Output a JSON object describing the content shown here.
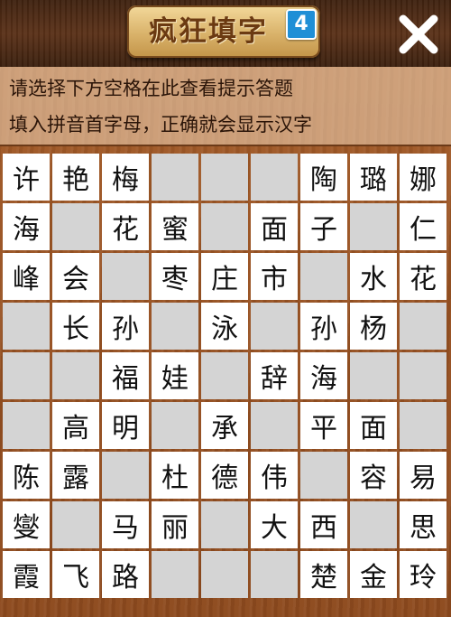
{
  "header": {
    "title": "疯狂填字",
    "badge": "4",
    "close_icon": "close-x-icon"
  },
  "hint": {
    "line1": "请选择下方空格在此查看提示答题",
    "line2": "填入拼音首字母，正确就会显示汉字"
  },
  "colors": {
    "wood": "#9a5424",
    "topbar": "#4a2814",
    "badge": "#1f8fd6",
    "cell_open": "#ffffff",
    "cell_block": "#d4d4d4"
  },
  "grid": {
    "rows": [
      [
        "许",
        "艳",
        "梅",
        null,
        null,
        null,
        "陶",
        "璐",
        "娜"
      ],
      [
        "海",
        null,
        "花",
        "蜜",
        null,
        "面",
        "子",
        null,
        "仁"
      ],
      [
        "峰",
        "会",
        null,
        "枣",
        "庄",
        "市",
        null,
        "水",
        "花"
      ],
      [
        null,
        "长",
        "孙",
        null,
        "泳",
        null,
        "孙",
        "杨",
        null
      ],
      [
        null,
        null,
        "福",
        "娃",
        null,
        "辞",
        "海",
        null,
        null
      ],
      [
        null,
        "高",
        "明",
        null,
        "承",
        null,
        "平",
        "面",
        null
      ],
      [
        "陈",
        "露",
        null,
        "杜",
        "德",
        "伟",
        null,
        "容",
        "易"
      ],
      [
        "燮",
        null,
        "马",
        "丽",
        null,
        "大",
        "西",
        null,
        "思"
      ],
      [
        "霞",
        "飞",
        "路",
        null,
        null,
        null,
        "楚",
        "金",
        "玲"
      ]
    ]
  }
}
